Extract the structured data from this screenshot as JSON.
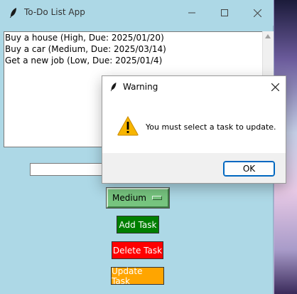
{
  "window": {
    "title": "To-Do List App"
  },
  "tasks": [
    "Buy a house (High, Due: 2025/01/20)",
    "Buy a car (Medium, Due: 2025/03/14)",
    "Get a new job (Low, Due: 2025/01/4)"
  ],
  "task_entry": {
    "value": ""
  },
  "priority": {
    "selected": "Medium"
  },
  "buttons": {
    "add": "Add Task",
    "delete": "Delete Task",
    "update": "Update Task"
  },
  "dialog": {
    "title": "Warning",
    "message": "You must select a task to update.",
    "ok_label": "OK"
  },
  "colors": {
    "app_background": "#add8e6",
    "add_button": "#007f00",
    "delete_button": "#ff0000",
    "update_button": "#ffa500",
    "priority_menu": "#77c47f",
    "warning_icon": "#f7b500"
  }
}
